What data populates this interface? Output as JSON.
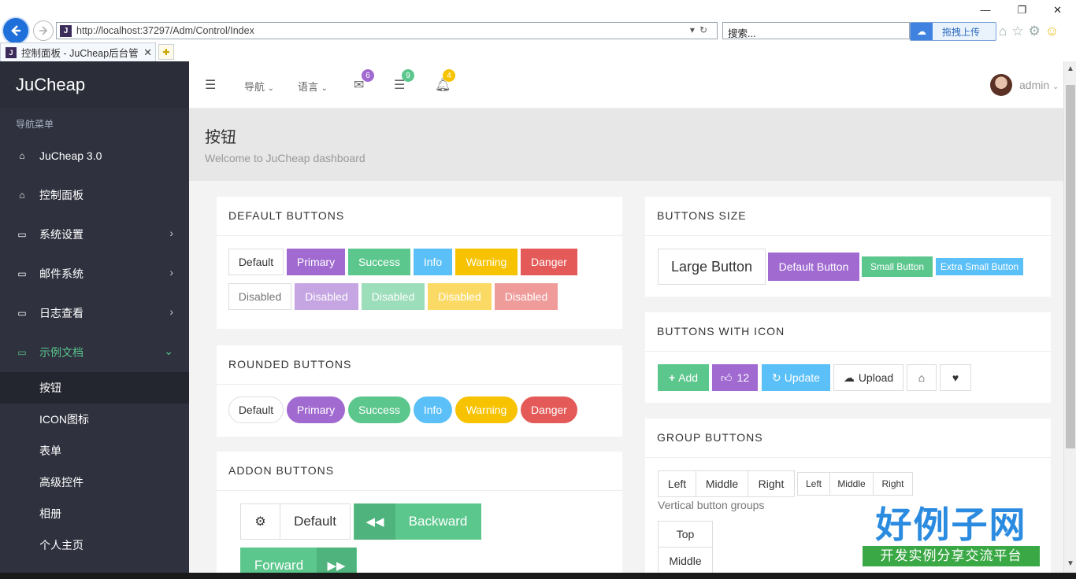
{
  "browser": {
    "url": "http://localhost:37297/Adm/Control/Index",
    "search_placeholder": "搜索...",
    "upload_ext": "拖拽上传",
    "tab_title": "控制面板 - JuCheap后台管",
    "favicon": "J"
  },
  "sidebar": {
    "brand": "JuCheap",
    "menu_header": "导航菜单",
    "items": [
      {
        "label": "JuCheap 3.0",
        "icon": "home-icon"
      },
      {
        "label": "控制面板",
        "icon": "home-icon"
      },
      {
        "label": "系统设置",
        "icon": "laptop-icon"
      },
      {
        "label": "邮件系统",
        "icon": "laptop-icon"
      },
      {
        "label": "日志查看",
        "icon": "laptop-icon"
      },
      {
        "label": "示例文档",
        "icon": "laptop-icon"
      }
    ],
    "sub_items": [
      "按钮",
      "ICON图标",
      "表单",
      "高级控件",
      "相册",
      "个人主页"
    ]
  },
  "topbar": {
    "nav_label": "导航",
    "lang_label": "语言",
    "mail_count": "6",
    "tasks_count": "9",
    "bell_count": "4",
    "user": "admin",
    "colors": {
      "mail": "#a06ad0",
      "tasks": "#5cc78d",
      "bell": "#f7c300"
    }
  },
  "page": {
    "title": "按钮",
    "subtitle": "Welcome to JuCheap dashboard"
  },
  "panels": {
    "default": {
      "title": "DEFAULT BUTTONS",
      "row1": [
        "Default",
        "Primary",
        "Success",
        "Info",
        "Warning",
        "Danger"
      ],
      "row2": [
        "Disabled",
        "Disabled",
        "Disabled",
        "Disabled",
        "Disabled"
      ]
    },
    "rounded": {
      "title": "ROUNDED BUTTONS",
      "buttons": [
        "Default",
        "Primary",
        "Success",
        "Info",
        "Warning",
        "Danger"
      ]
    },
    "addon": {
      "title": "ADDON BUTTONS",
      "default": "Default",
      "backward": "Backward",
      "forward": "Forward"
    },
    "size": {
      "title": "BUTTONS SIZE",
      "buttons": [
        "Large Button",
        "Default Button",
        "Small Button",
        "Extra Small Button"
      ]
    },
    "icon": {
      "title": "BUTTONS WITH ICON",
      "add": "Add",
      "likes": "12",
      "update": "Update",
      "upload": "Upload"
    },
    "group": {
      "title": "GROUP BUTTONS",
      "group1": [
        "Left",
        "Middle",
        "Right"
      ],
      "group2": [
        "Left",
        "Middle",
        "Right"
      ],
      "vertical_label": "Vertical button groups",
      "vertical": [
        "Top",
        "Middle"
      ]
    }
  },
  "watermark": {
    "logo_main": "好例子网",
    "logo_sub": "开发实例分享交流平台"
  }
}
